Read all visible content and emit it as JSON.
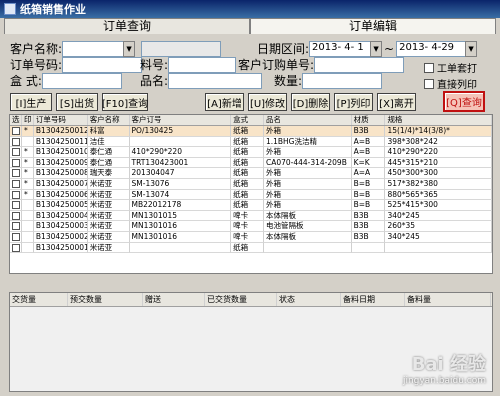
{
  "window": {
    "title": "纸箱销售作业"
  },
  "tabs": [
    "订单查询",
    "订单编辑"
  ],
  "filters": {
    "customer_name_label": "客户名称:",
    "customer_code_value": "",
    "customer_name_value": "",
    "date_range_label": "日期区间:",
    "date_from": "2013- 4- 1",
    "date_sep": "~",
    "date_to": "2013- 4-29",
    "order_no_label": "订单号码:",
    "order_no_value": "",
    "material_no_label": "料号:",
    "material_no_value": "",
    "customer_po_label": "客户订购单号:",
    "customer_po_value": "",
    "box_type_label": "盒    式:",
    "box_type_value": "",
    "product_name_label": "品名:",
    "product_name_value": "",
    "quantity_label": "数量:",
    "quantity_value": "",
    "work_order_print_label": "工单套打",
    "direct_print_label": "直接列印"
  },
  "toolbar": {
    "produce": "[I]生产",
    "ship": "[S]出货",
    "f10_query": "[F10]查询",
    "add": "[A]新增",
    "edit": "[U]修改",
    "delete": "[D]删除",
    "print": "[P]列印",
    "leave": "[X]离开",
    "query": "[Q]查询"
  },
  "grid": {
    "headers": [
      "选",
      "印",
      "订单号码",
      "客户名称",
      "客户订号",
      "盒式",
      "品名",
      "材质",
      "规格"
    ],
    "rows": [
      {
        "sel": "",
        "yin": "*",
        "order": "B1304250012",
        "cust": "科富",
        "po": "PO/130425",
        "box": "纸箱",
        "name": "外箱",
        "mat": "B3B",
        "spec": "15(1/4)*14(3/8)*"
      },
      {
        "sel": "",
        "yin": "",
        "order": "B1304250011",
        "cust": "洁佳",
        "po": "",
        "box": "纸箱",
        "name": "1.1BHG洗洁精",
        "mat": "A=B",
        "spec": "398*308*242"
      },
      {
        "sel": "",
        "yin": "*",
        "order": "B1304250010",
        "cust": "泰仁通",
        "po": "410*290*220",
        "box": "纸箱",
        "name": "外箱",
        "mat": "A=B",
        "spec": "410*290*220"
      },
      {
        "sel": "",
        "yin": "*",
        "order": "B1304250009",
        "cust": "泰仁通",
        "po": "TRT130423001",
        "box": "纸箱",
        "name": "CA070-444-314-209B",
        "mat": "K=K",
        "spec": "445*315*210"
      },
      {
        "sel": "",
        "yin": "*",
        "order": "B1304250008",
        "cust": "瑞天泰",
        "po": "201304047",
        "box": "纸箱",
        "name": "外箱",
        "mat": "A=A",
        "spec": "450*300*300"
      },
      {
        "sel": "",
        "yin": "*",
        "order": "B1304250007",
        "cust": "米诺亚",
        "po": "SM-13076",
        "box": "纸箱",
        "name": "外箱",
        "mat": "B=B",
        "spec": "517*382*380"
      },
      {
        "sel": "",
        "yin": "*",
        "order": "B1304250006",
        "cust": "米诺亚",
        "po": "SM-13074",
        "box": "纸箱",
        "name": "外箱",
        "mat": "B=B",
        "spec": "880*565*365"
      },
      {
        "sel": "",
        "yin": "",
        "order": "B1304250005",
        "cust": "米诺亚",
        "po": "MB22012178",
        "box": "纸箱",
        "name": "外箱",
        "mat": "B=B",
        "spec": "525*415*300"
      },
      {
        "sel": "",
        "yin": "",
        "order": "B1304250004",
        "cust": "米诺亚",
        "po": "MN1301015",
        "box": "啤卡",
        "name": "本体隔板",
        "mat": "B3B",
        "spec": "340*245"
      },
      {
        "sel": "",
        "yin": "",
        "order": "B1304250003",
        "cust": "米诺亚",
        "po": "MN1301016",
        "box": "啤卡",
        "name": "电池管隔板",
        "mat": "B3B",
        "spec": "260*35"
      },
      {
        "sel": "",
        "yin": "",
        "order": "B1304250002",
        "cust": "米诺亚",
        "po": "MN1301016",
        "box": "啤卡",
        "name": "本体隔板",
        "mat": "B3B",
        "spec": "340*245"
      },
      {
        "sel": "",
        "yin": "",
        "order": "B1304250001",
        "cust": "米诺亚",
        "po": "",
        "box": "纸箱",
        "name": "",
        "mat": "",
        "spec": ""
      }
    ]
  },
  "detail": {
    "headers": [
      "交货量",
      "预交数量",
      "赠送",
      "已交货数量",
      "状态",
      "备料日期",
      "备料量"
    ]
  },
  "watermark": {
    "brand": "Bai 经验",
    "url": "jingyan.baidu.com"
  }
}
